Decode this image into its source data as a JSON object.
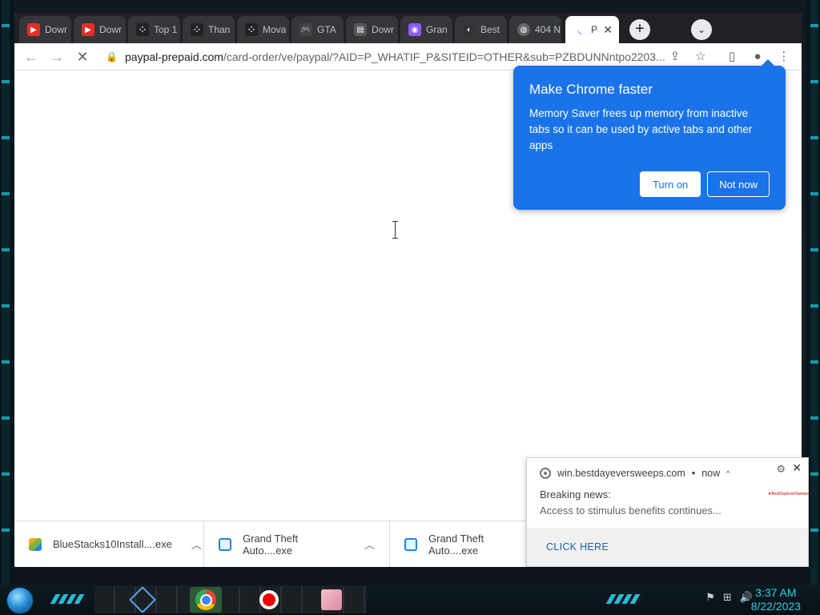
{
  "browser": {
    "tabs": [
      {
        "title": "Dowr",
        "favicon": "youtube-icon",
        "color": "#e52d27"
      },
      {
        "title": "Dowr",
        "favicon": "youtube-icon",
        "color": "#e52d27"
      },
      {
        "title": "Top 1",
        "favicon": "dice-icon",
        "color": "#222222"
      },
      {
        "title": "Than",
        "favicon": "dice-icon",
        "color": "#222222"
      },
      {
        "title": "Mova",
        "favicon": "dice-icon",
        "color": "#222222"
      },
      {
        "title": "GTA",
        "favicon": "gamepad-icon",
        "color": "#444444"
      },
      {
        "title": "Dowr",
        "favicon": "page-icon",
        "color": "#555555"
      },
      {
        "title": "Gran",
        "favicon": "gamepad-icon",
        "color": "#8a5cf6"
      },
      {
        "title": "Best",
        "favicon": "globe-icon",
        "color": "#333333"
      },
      {
        "title": "404 N",
        "favicon": "globe-icon",
        "color": "#666666"
      }
    ],
    "active_tab": {
      "title": "Pa",
      "close": "✕"
    },
    "new_tab": "+",
    "tab_search": "⌄",
    "url_host": "paypal-prepaid.com",
    "url_path": "/card-order/ve/paypal/?AID=P_WHATIF_P&SITEID=OTHER&sub=PZBDUNNntpo2203..."
  },
  "bubble": {
    "title": "Make Chrome faster",
    "body": "Memory Saver frees up memory from inactive tabs so it can be used by active tabs and other apps",
    "primary": "Turn on",
    "secondary": "Not now"
  },
  "downloads": [
    {
      "name": "BlueStacks10Install....exe",
      "icon": "bluestacks-icon",
      "color": "#7cb342"
    },
    {
      "name": "Grand Theft Auto....exe",
      "icon": "installer-icon",
      "color": "#1e88e5"
    },
    {
      "name": "Grand Theft Auto....exe",
      "icon": "installer-icon",
      "color": "#1e88e5"
    }
  ],
  "notification": {
    "source": "win.bestdayeversweeps.com",
    "time": "now",
    "title": "Breaking news:",
    "body": "Access to stimulus benefits continues...",
    "action": "CLICK HERE",
    "brand": "BestDayEverSweeps"
  },
  "taskbar": {
    "time": "3:37 AM",
    "date": "8/22/2023"
  }
}
